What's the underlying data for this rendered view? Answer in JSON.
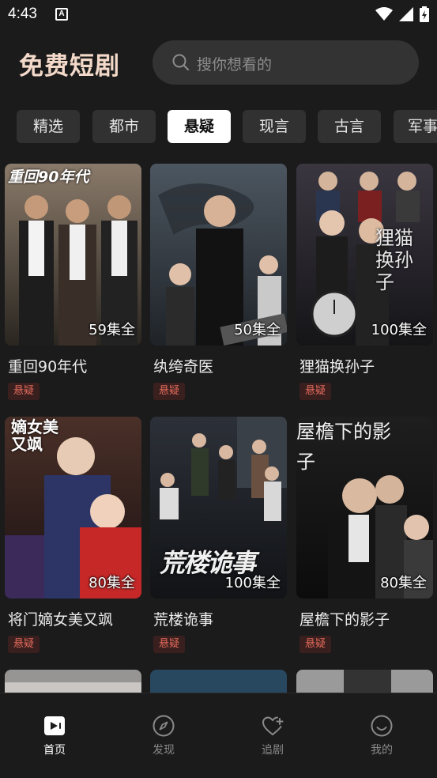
{
  "status_bar": {
    "time": "4:43",
    "notification_letter": "A"
  },
  "header": {
    "app_title": "免费短剧",
    "search_placeholder": "搜你想看的"
  },
  "tabs": [
    {
      "label": "精选",
      "active": false
    },
    {
      "label": "都市",
      "active": false
    },
    {
      "label": "悬疑",
      "active": true
    },
    {
      "label": "现言",
      "active": false
    },
    {
      "label": "古言",
      "active": false
    },
    {
      "label": "军事",
      "active": false
    }
  ],
  "dramas": [
    {
      "title": "重回90年代",
      "episodes": "59集全",
      "tag": "悬疑",
      "poster_text": "重回90年代"
    },
    {
      "title": "纨绔奇医",
      "episodes": "50集全",
      "tag": "悬疑",
      "poster_text": ""
    },
    {
      "title": "狸猫换孙子",
      "episodes": "100集全",
      "tag": "悬疑",
      "poster_text": "狸猫换孙子"
    },
    {
      "title": "将门嫡女美又飒",
      "episodes": "80集全",
      "tag": "悬疑",
      "poster_text": "嫡女美又飒"
    },
    {
      "title": "荒楼诡事",
      "episodes": "100集全",
      "tag": "悬疑",
      "poster_text": "荒楼诡事"
    },
    {
      "title": "屋檐下的影子",
      "episodes": "80集全",
      "tag": "悬疑",
      "poster_text": "屋檐下的影子"
    }
  ],
  "bottom_nav": [
    {
      "label": "首页",
      "icon": "play-video-icon",
      "active": true
    },
    {
      "label": "发现",
      "icon": "compass-icon",
      "active": false
    },
    {
      "label": "追剧",
      "icon": "heart-plus-icon",
      "active": false
    },
    {
      "label": "我的",
      "icon": "smile-face-icon",
      "active": false
    }
  ],
  "colors": {
    "background": "#1b1b1b",
    "title_accent": "#f3d9c9",
    "tag_text": "#e06a5a",
    "tag_bg": "#3a1f1f"
  }
}
